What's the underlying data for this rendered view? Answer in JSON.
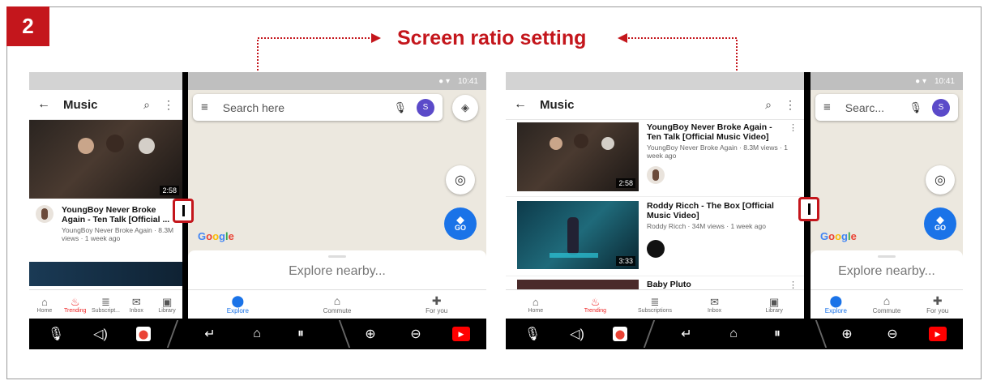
{
  "step_number": "2",
  "title": "Screen ratio setting",
  "colors": {
    "accent": "#c4161c",
    "maps_blue": "#1a73e8",
    "yt_red": "#e22"
  },
  "screen_left": {
    "youtube": {
      "header_title": "Music",
      "video": {
        "title": "YoungBoy Never Broke Again - Ten Talk [Official ...",
        "meta": "YoungBoy Never Broke Again · 8.3M views · 1 week ago",
        "duration": "2:58"
      },
      "nav": [
        "Home",
        "Trending",
        "Subscript...",
        "Inbox",
        "Library"
      ]
    },
    "maps": {
      "time": "10:41",
      "search_placeholder": "Search here",
      "avatar_letter": "S",
      "go_label": "GO",
      "explore_text": "Explore nearby...",
      "nav": [
        "Explore",
        "Commute",
        "For you"
      ]
    }
  },
  "screen_right": {
    "youtube": {
      "header_title": "Music",
      "videos": [
        {
          "title": "YoungBoy Never Broke Again - Ten Talk [Official Music Video]",
          "meta": "YoungBoy Never Broke Again · 8.3M views · 1 week ago",
          "duration": "2:58"
        },
        {
          "title": "Roddy Ricch - The Box [Official Music Video]",
          "meta": "Roddy Ricch · 34M views · 1 week ago",
          "duration": "3:33"
        },
        {
          "title": "Baby Pluto",
          "meta": "",
          "duration": ""
        }
      ],
      "nav": [
        "Home",
        "Trending",
        "Subscriptions",
        "Inbox",
        "Library"
      ]
    },
    "maps": {
      "time": "10:41",
      "search_placeholder": "Searc...",
      "avatar_letter": "S",
      "go_label": "GO",
      "explore_text": "Explore nearby...",
      "nav": [
        "Explore",
        "Commute",
        "For you"
      ]
    }
  },
  "google_logo": [
    "G",
    "o",
    "o",
    "g",
    "l",
    "e"
  ],
  "icons": {
    "back": "arrow-left-icon",
    "search": "search-icon",
    "more": "more-vert-icon",
    "mic": "mic-icon",
    "layers": "layers-icon",
    "location": "my-location-icon",
    "home": "home-icon",
    "trending": "trending-icon",
    "subscriptions": "subscriptions-icon",
    "inbox": "inbox-icon",
    "library": "library-icon",
    "explore": "explore-pin-icon",
    "commute": "commute-icon",
    "foryou": "for-you-icon",
    "assistant": "mic-icon",
    "volume": "volume-icon",
    "maps_app": "maps-app-icon",
    "sys_back": "back-icon",
    "sys_home": "home-icon",
    "recents": "recents-icon",
    "zoom_in": "zoom-in-icon",
    "zoom_out": "zoom-out-icon",
    "youtube_app": "youtube-app-icon"
  }
}
